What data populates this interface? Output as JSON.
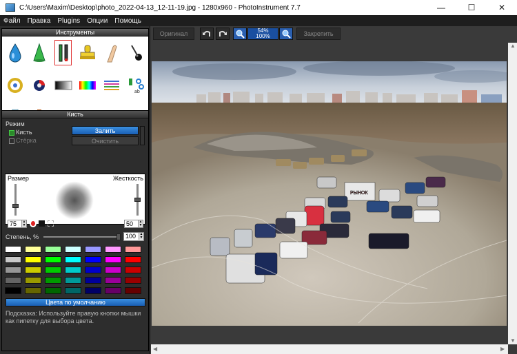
{
  "window": {
    "title": "C:\\Users\\Maxim\\Desktop\\photo_2022-04-13_12-11-19.jpg - 1280x960 - PhotoInstrument 7.7",
    "minimize": "—",
    "maximize": "☐",
    "close": "✕"
  },
  "menu": [
    "Файл",
    "Правка",
    "Plugins",
    "Опции",
    "Помощь"
  ],
  "tools_panel": {
    "title": "Инструменты",
    "tools": [
      "drop-tool-icon",
      "cone-tool-icon",
      "brush-tool-icon",
      "stamp-tool-icon",
      "finger-tool-icon",
      "pin-tool-icon",
      "ring-tool-icon",
      "color-ball-icon",
      "gradient-tool-icon",
      "rainbow-tool-icon",
      "lines-tool-icon",
      "scissors-tool-icon",
      "tube-tool-icon",
      "bottle-tool-icon",
      "bulb-tool-icon",
      "eraser-tool-icon",
      "frame-tool-icon",
      "text-tool-icon"
    ],
    "selected_index": 2
  },
  "brush_panel": {
    "title": "Кисть",
    "mode_label": "Режим",
    "brush_option": "Кисть",
    "eraser_option": "Стёрка",
    "fill_button": "Залить",
    "clear_button": "Очистить",
    "size_label": "Размер",
    "hardness_label": "Жесткость",
    "size_value": "75",
    "hardness_value": "50",
    "strength_label": "Степень, %",
    "strength_value": "100",
    "default_colors_button": "Цвета по умолчанию",
    "hint": "Подсказка: Используйте правую кнопки мышки как пипетку для выбора цвета."
  },
  "palette": [
    [
      "#ffffff",
      "#ffff99",
      "#99ff99",
      "#ccffff",
      "#9999ff",
      "#ff99ff",
      "#ff9999"
    ],
    [
      "#c8c8c8",
      "#ffff00",
      "#00ff00",
      "#00ffff",
      "#0000ff",
      "#ff00ff",
      "#ff0000"
    ],
    [
      "#969696",
      "#cccc00",
      "#00cc00",
      "#00cccc",
      "#0000cc",
      "#cc00cc",
      "#cc0000"
    ],
    [
      "#646464",
      "#999900",
      "#009900",
      "#009999",
      "#000099",
      "#990099",
      "#990000"
    ],
    [
      "#000000",
      "#666600",
      "#006600",
      "#006666",
      "#000066",
      "#660066",
      "#660000"
    ]
  ],
  "toolbar": {
    "original_button": "Оригинал",
    "undo": "undo-icon",
    "redo": "redo-icon",
    "zoom_in": "zoom-in-icon",
    "zoom_level": "54%",
    "zoom_100": "100%",
    "zoom_out": "zoom-out-icon",
    "save_button": "Закрепить"
  },
  "image": {
    "banner_text": "РЫНОК"
  }
}
